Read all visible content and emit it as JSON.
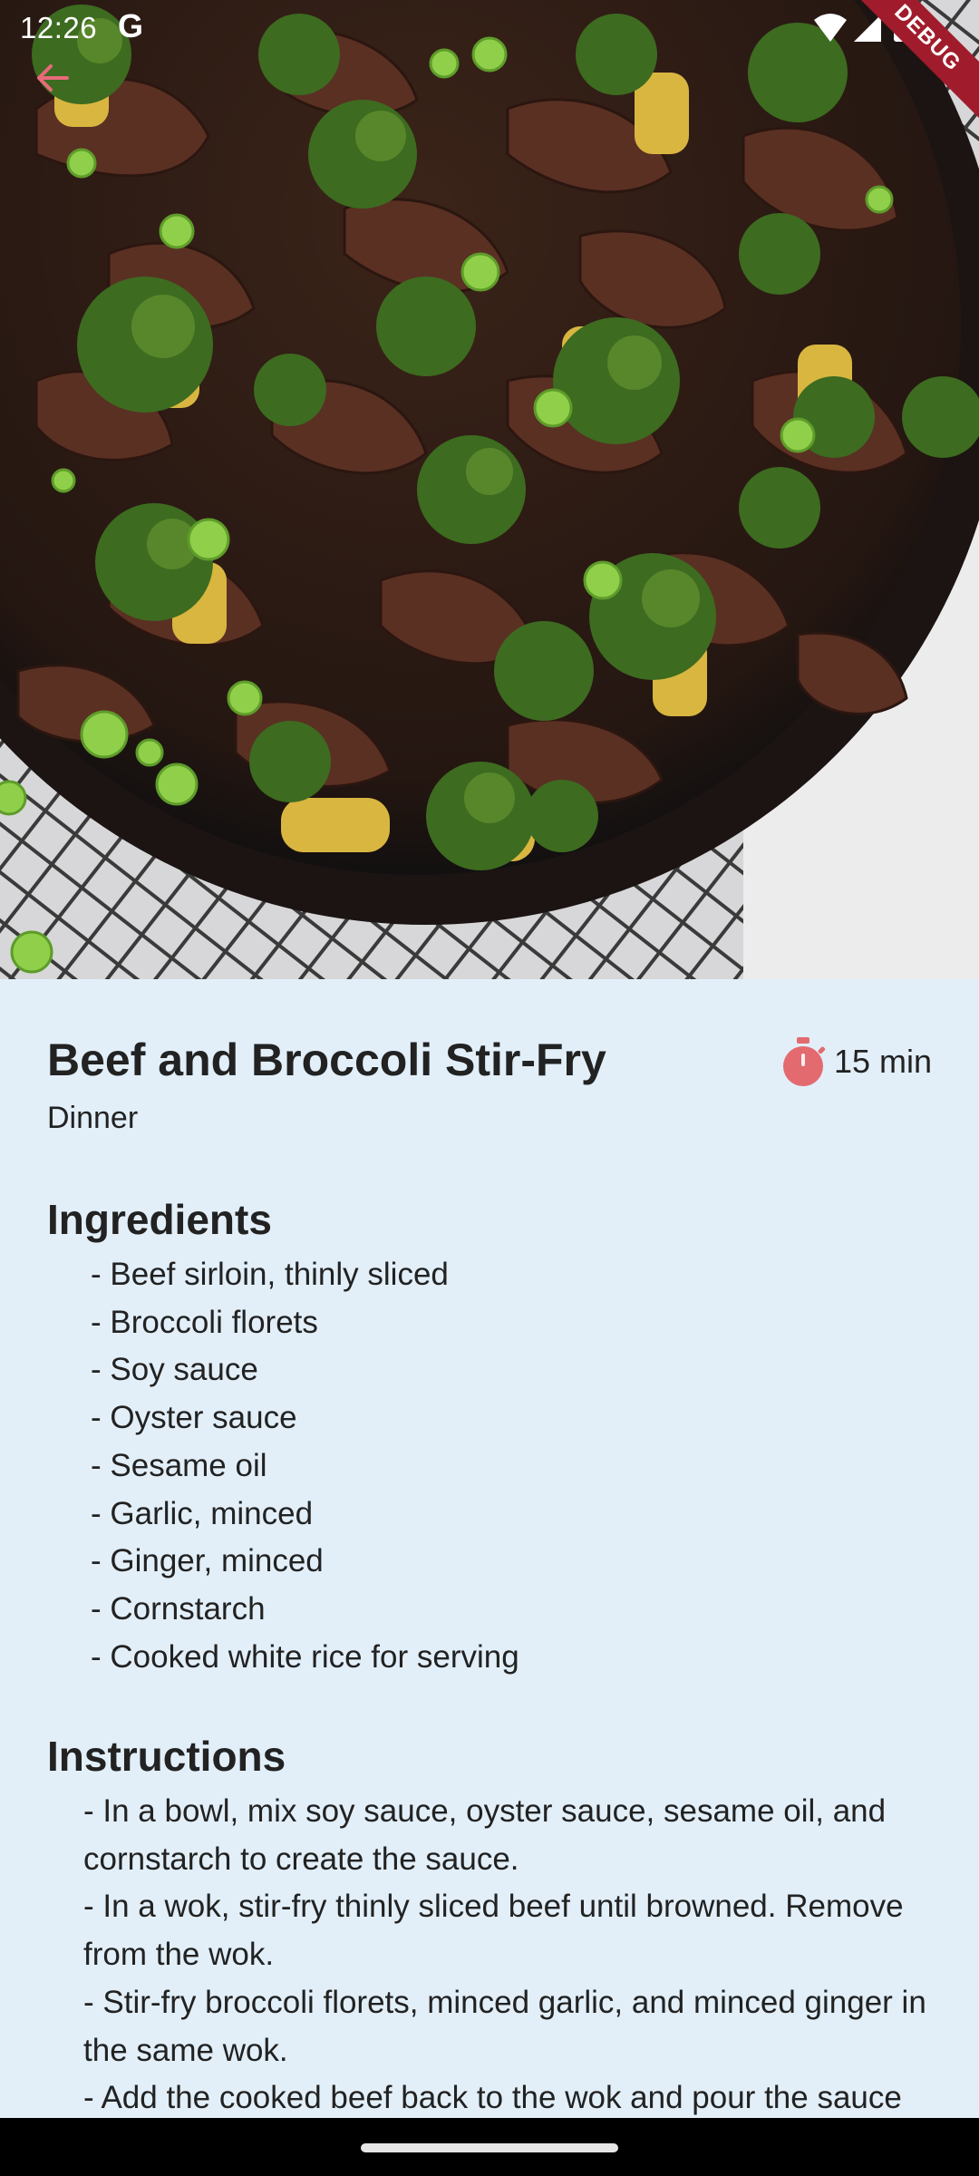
{
  "status_bar": {
    "time": "12:26",
    "g_label": "G",
    "icons": [
      "wifi-icon",
      "signal-icon",
      "battery-icon"
    ],
    "debug_label": "DEBUG"
  },
  "hero": {
    "description_icon": "food-photo",
    "back_icon": "arrow-back-icon",
    "accent": "#e86a7a"
  },
  "recipe": {
    "title": "Beef and Broccoli Stir-Fry",
    "category": "Dinner",
    "time": "15 min",
    "timer_icon": "timer-icon",
    "timer_color": "#e36a6f",
    "ingredients_heading": "Ingredients",
    "ingredients": [
      "- Beef sirloin, thinly sliced",
      "- Broccoli florets",
      "- Soy sauce",
      "- Oyster sauce",
      "- Sesame oil",
      "- Garlic, minced",
      "- Ginger, minced",
      "- Cornstarch",
      "- Cooked white rice for serving"
    ],
    "instructions_heading": "Instructions",
    "instructions": [
      "- In a bowl, mix soy sauce, oyster sauce, sesame oil, and cornstarch to create the sauce.",
      "- In a wok, stir-fry thinly sliced beef until browned. Remove from the wok.",
      "- Stir-fry broccoli florets, minced garlic, and minced ginger in the same wok.",
      "- Add the cooked beef back to the wok and pour the sauce over the mixture."
    ]
  },
  "colors": {
    "background": "#e2eff9",
    "text": "#222222",
    "nav_bar": "#000000"
  }
}
